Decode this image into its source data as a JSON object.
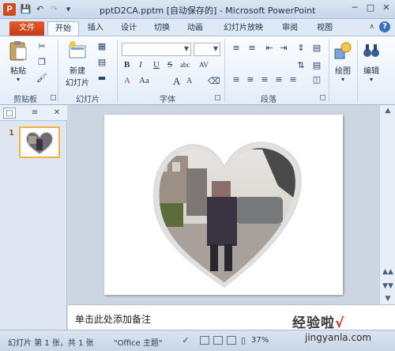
{
  "window": {
    "title": "pptD2CA.pptm [自动保存的] - Microsoft PowerPoint",
    "app_icon_letter": "P",
    "window_buttons": [
      "minimize",
      "maximize",
      "close"
    ]
  },
  "ribbon_tabs": [
    "文件",
    "开始",
    "插入",
    "设计",
    "切换",
    "动画",
    "幻灯片放映",
    "审阅",
    "视图"
  ],
  "active_tab": "开始",
  "ribbon": {
    "clipboard": {
      "paste_label": "粘贴",
      "group_label": "剪贴板"
    },
    "slides": {
      "new_slide_label_1": "新建",
      "new_slide_label_2": "幻灯片",
      "group_label": "幻灯片"
    },
    "font": {
      "bold": "B",
      "italic": "I",
      "underline": "U",
      "strike": "S",
      "shadow": "abc",
      "spacing": "AV",
      "font_color": "A",
      "grow": "A",
      "shrink": "A",
      "case": "Aa",
      "group_label": "字体"
    },
    "paragraph": {
      "group_label": "段落"
    },
    "drawing": {
      "label": "绘图"
    },
    "editing": {
      "label": "编辑"
    }
  },
  "slides_pane": {
    "slide_number": "1"
  },
  "notes": {
    "placeholder": "单击此处添加备注"
  },
  "status_bar": {
    "slide_info": "幻灯片 第 1 张，共 1 张",
    "theme": "\"Office 主题\"",
    "zoom": "37%"
  },
  "watermark": {
    "text": "经验啦",
    "check": "√",
    "url": "jingyanla.com"
  },
  "colors": {
    "file_tab": "#d34a1e",
    "thumb_border": "#f2b43a",
    "watermark_check": "#e01b1b"
  }
}
